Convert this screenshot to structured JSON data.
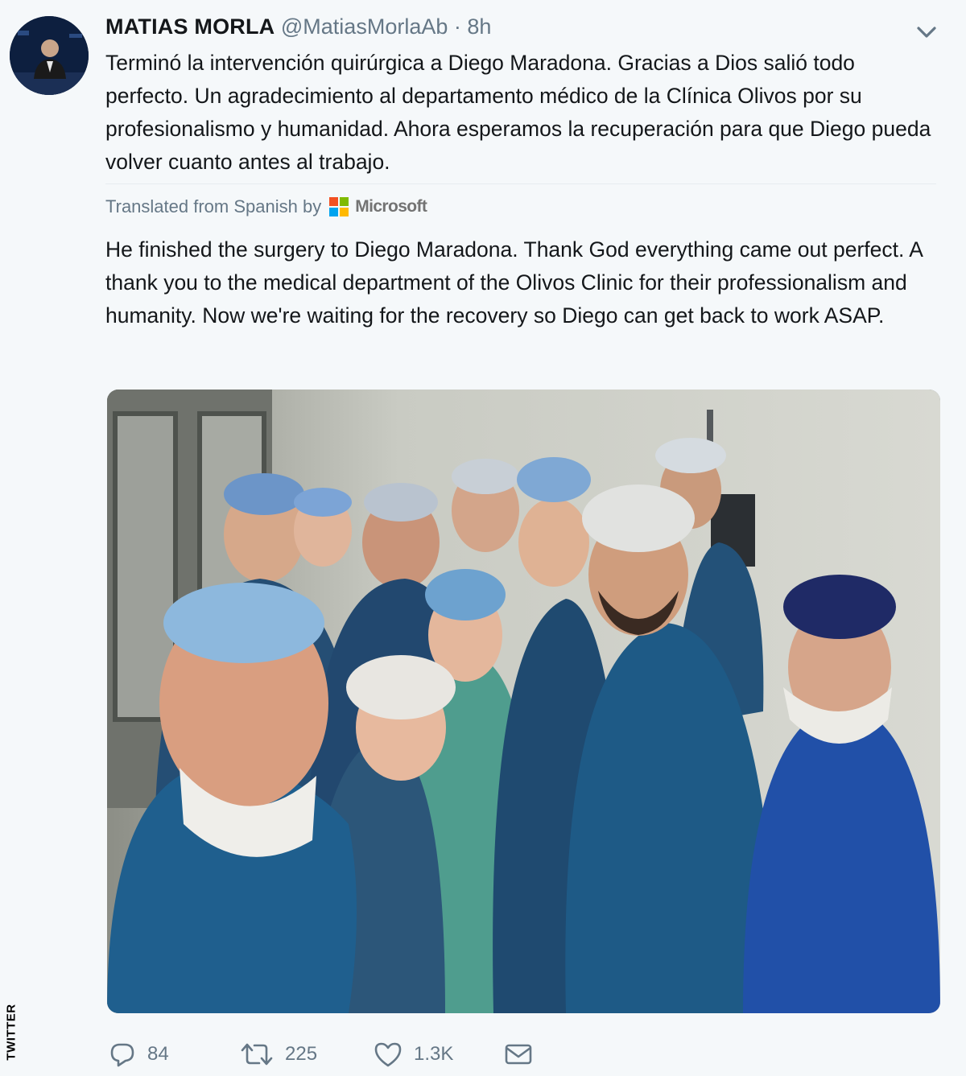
{
  "tweet": {
    "author_name": "MATIAS MORLA",
    "handle": "@MatiasMorlaAb",
    "separator": "·",
    "time": "8h",
    "text": "Terminó la intervención quirúrgica a Diego Maradona. Gracias a Dios salió todo perfecto. Un agradecimiento al departamento médico de la Clínica Olivos por su profesionalismo y humanidad. Ahora esperamos la recuperación para que Diego pueda volver cuanto antes al trabajo.",
    "translated_label": "Translated from Spanish by",
    "translator": "Microsoft",
    "translation": "He finished the surgery to Diego Maradona. Thank God everything came out perfect. A thank you to the medical department of the Olivos Clinic for their professionalism and humanity. Now we're waiting for the recovery so Diego can get back to work ASAP."
  },
  "actions": {
    "replies": "84",
    "retweets": "225",
    "likes": "1.3K"
  },
  "icons": [
    "avatar",
    "chevron-down-icon",
    "microsoft-logo",
    "reply-icon",
    "retweet-icon",
    "heart-icon",
    "mail-icon"
  ],
  "colors": {
    "text": "#14171a",
    "muted": "#657786",
    "ms_red": "#f25022",
    "ms_green": "#7fba00",
    "ms_blue": "#00a4ef",
    "ms_yellow": "#ffb900"
  },
  "watermark": "TWITTER"
}
